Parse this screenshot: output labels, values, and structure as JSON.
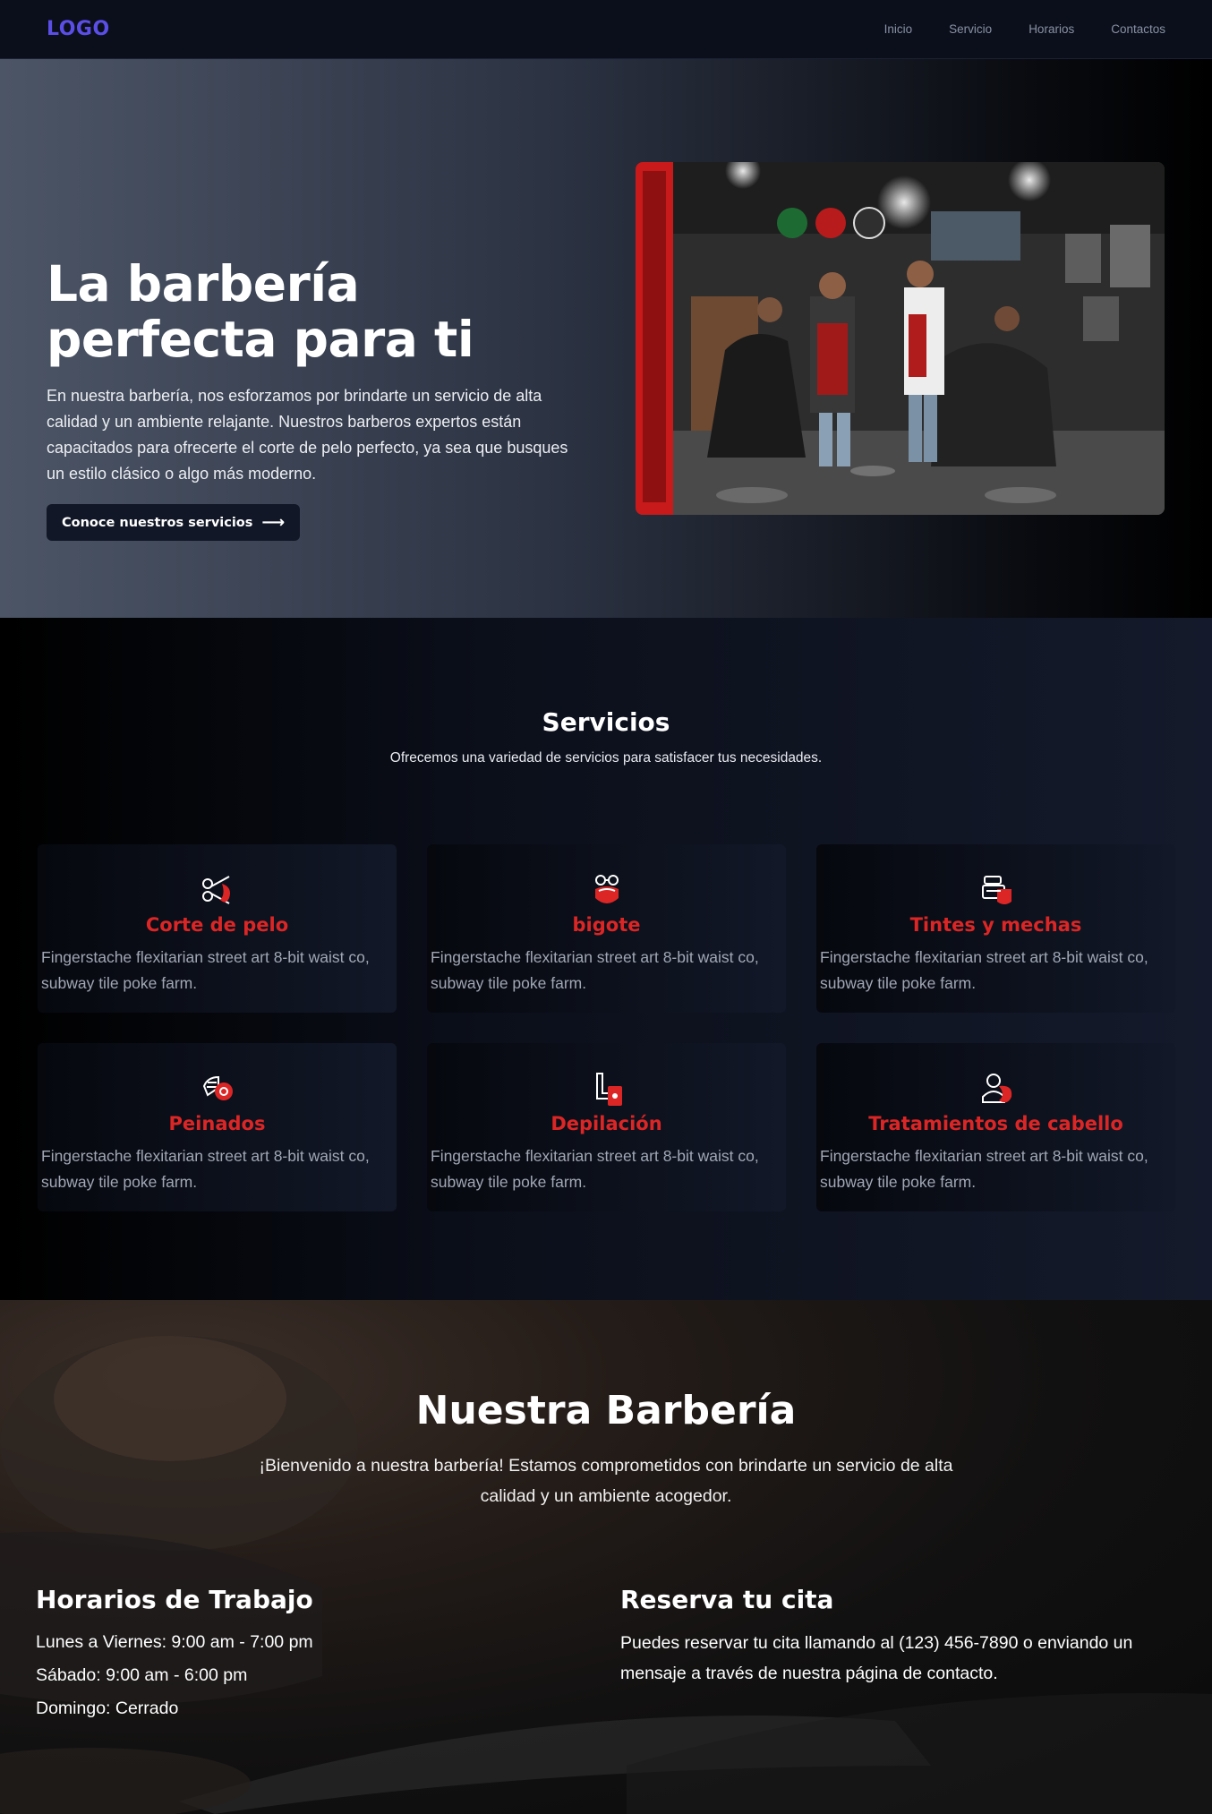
{
  "nav": {
    "logo": "LOGO",
    "links": [
      "Inicio",
      "Servicio",
      "Horarios",
      "Contactos"
    ]
  },
  "hero": {
    "title": "La barbería perfecta para ti",
    "description": "En nuestra barbería, nos esforzamos por brindarte un servicio de alta calidad y un ambiente relajante. Nuestros barberos expertos están capacitados para ofrecerte el corte de pelo perfecto, ya sea que busques un estilo clásico o algo más moderno.",
    "cta_label": "Conoce nuestros servicios",
    "cta_icon": "arrow-right-icon"
  },
  "services": {
    "title": "Servicios",
    "subtitle": "Ofrecemos una variedad de servicios para satisfacer tus necesidades.",
    "items": [
      {
        "title": "Corte de pelo",
        "description": "Fingerstache flexitarian street art 8-bit waist co, subway tile poke farm.",
        "icon": "scissors-icon"
      },
      {
        "title": "bigote",
        "description": "Fingerstache flexitarian street art 8-bit waist co, subway tile poke farm.",
        "icon": "mustache-icon"
      },
      {
        "title": "Tintes y mechas",
        "description": "Fingerstache flexitarian street art 8-bit waist co, subway tile poke farm.",
        "icon": "hair-dye-icon"
      },
      {
        "title": "Peinados",
        "description": "Fingerstache flexitarian street art 8-bit waist co, subway tile poke farm.",
        "icon": "comb-icon"
      },
      {
        "title": "Depilación",
        "description": "Fingerstache flexitarian street art 8-bit waist co, subway tile poke farm.",
        "icon": "razor-icon"
      },
      {
        "title": "Tratamientos de cabello",
        "description": "Fingerstache flexitarian street art 8-bit waist co, subway tile poke farm.",
        "icon": "hair-treatment-icon"
      }
    ]
  },
  "barberia": {
    "title": "Nuestra Barbería",
    "text": "¡Bienvenido a nuestra barbería! Estamos comprometidos con brindarte un servicio de alta calidad y un ambiente acogedor.",
    "hours_title": "Horarios de Trabajo",
    "hours": [
      "Lunes a Viernes: 9:00 am - 7:00 pm",
      "Sábado: 9:00 am - 6:00 pm",
      "Domingo: Cerrado"
    ],
    "booking_title": "Reserva tu cita",
    "booking_text": "Puedes reservar tu cita llamando al (123) 456-7890 o enviando un mensaje a través de nuestra página de contacto."
  },
  "colors": {
    "accent": "#dc2626",
    "logo": "#5b4ee6",
    "nav_bg": "#0b0f1c"
  }
}
